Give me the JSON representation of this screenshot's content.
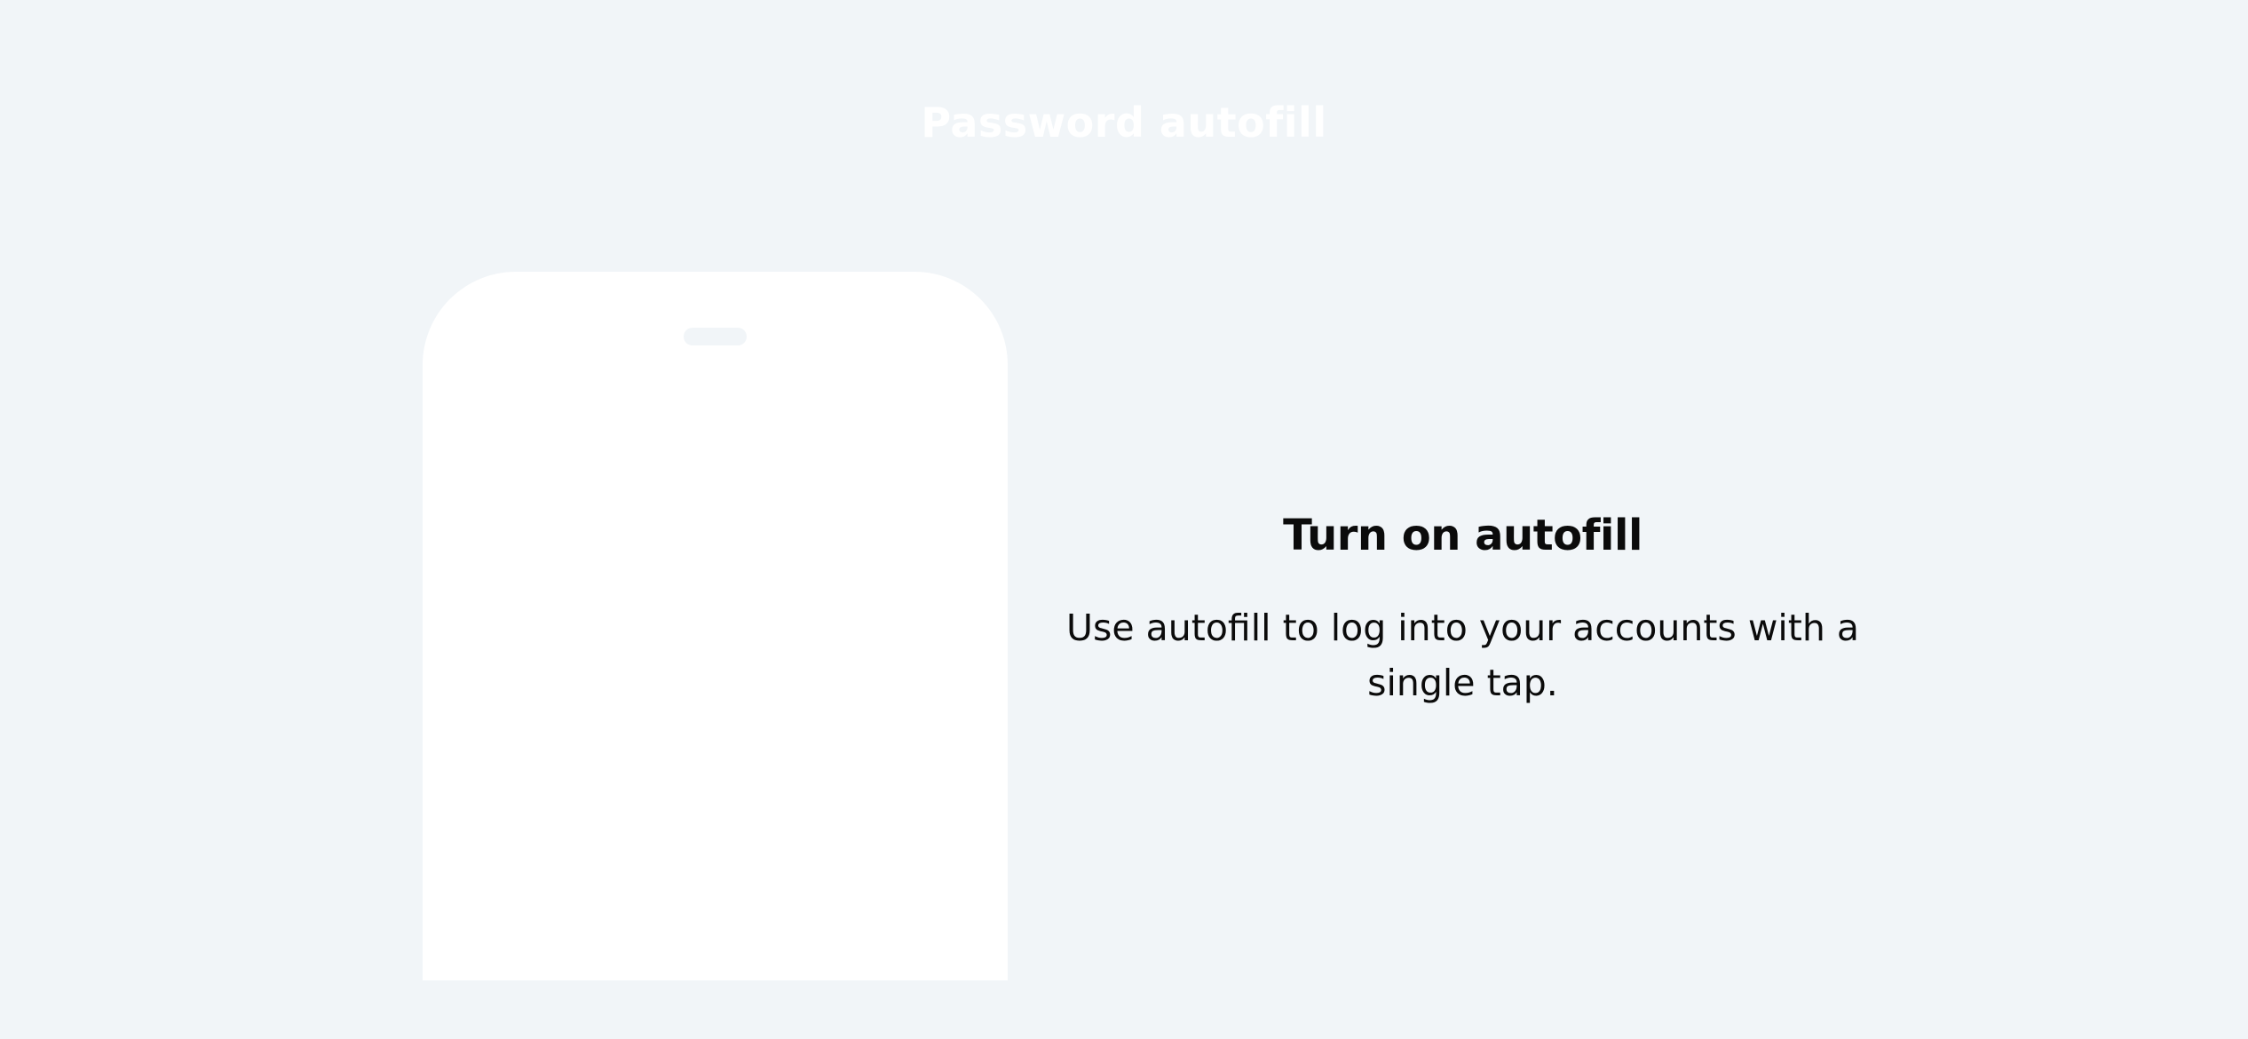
{
  "header": {
    "title": "Password autofill"
  },
  "onboarding": {
    "title": "Turn on autofill",
    "description": "Use autofill to log into your accounts with a single tap."
  },
  "colors": {
    "background": "#f1f5f8",
    "phone": "#ffffff",
    "text": "#0b0b0b"
  }
}
